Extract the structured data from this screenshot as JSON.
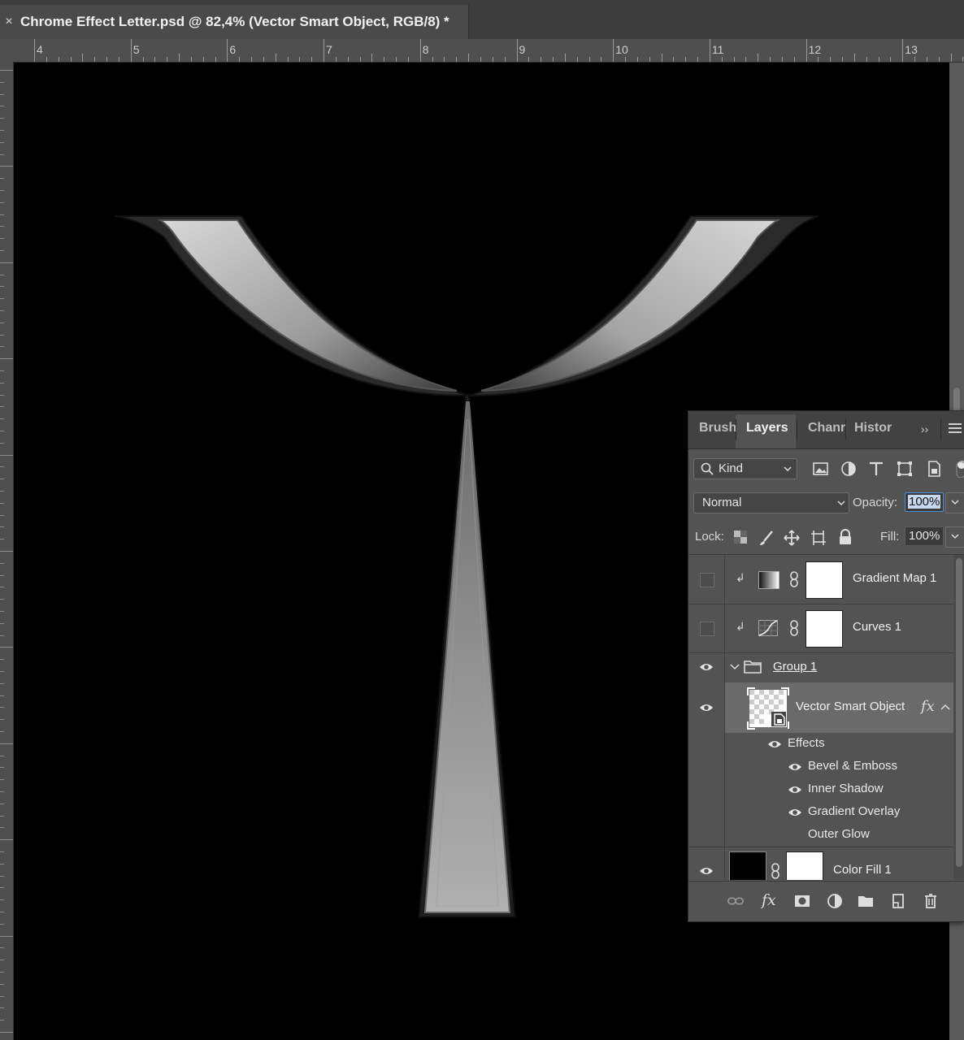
{
  "document": {
    "title": "Chrome Effect Letter.psd @ 82,4% (Vector Smart Object, RGB/8) *",
    "close_glyph": "×"
  },
  "ruler": {
    "labels": [
      "4",
      "5",
      "6",
      "7",
      "8",
      "9",
      "10",
      "11",
      "12",
      "13"
    ]
  },
  "panel": {
    "tabs": [
      "Brush",
      "Layers",
      "Chanr",
      "Histor"
    ],
    "active_tab": "Layers",
    "collapse_glyph": "››",
    "filter": {
      "kind_label": "Kind"
    },
    "filter_icons": [
      "image-filter-icon",
      "adjustment-filter-icon",
      "type-filter-icon",
      "shape-filter-icon",
      "smart-object-filter-icon"
    ],
    "blend_mode": "Normal",
    "opacity_label": "Opacity:",
    "opacity_value": "100%",
    "lock_label": "Lock:",
    "lock_icons": [
      "lock-transparent-icon",
      "lock-paint-icon",
      "lock-position-icon",
      "lock-artboard-icon",
      "lock-all-icon"
    ],
    "fill_label": "Fill:",
    "fill_value": "100%",
    "layers": {
      "gradient_map": {
        "name": "Gradient Map 1",
        "visible": false
      },
      "curves": {
        "name": "Curves 1",
        "visible": false
      },
      "group": {
        "name": "Group 1",
        "visible": true
      },
      "smart_object": {
        "name": "Vector Smart Object",
        "fx": "fx",
        "visible": true
      },
      "effects_label": "Effects",
      "effects": [
        "Bevel & Emboss",
        "Inner Shadow",
        "Gradient Overlay",
        "Outer Glow"
      ],
      "color_fill": {
        "name": "Color Fill 1",
        "visible": true
      }
    },
    "footer_icons": [
      "link-layers-icon",
      "fx-icon",
      "add-mask-icon",
      "adjustment-layer-icon",
      "new-group-icon",
      "new-layer-icon",
      "delete-icon"
    ],
    "footer_fx": "fx"
  }
}
